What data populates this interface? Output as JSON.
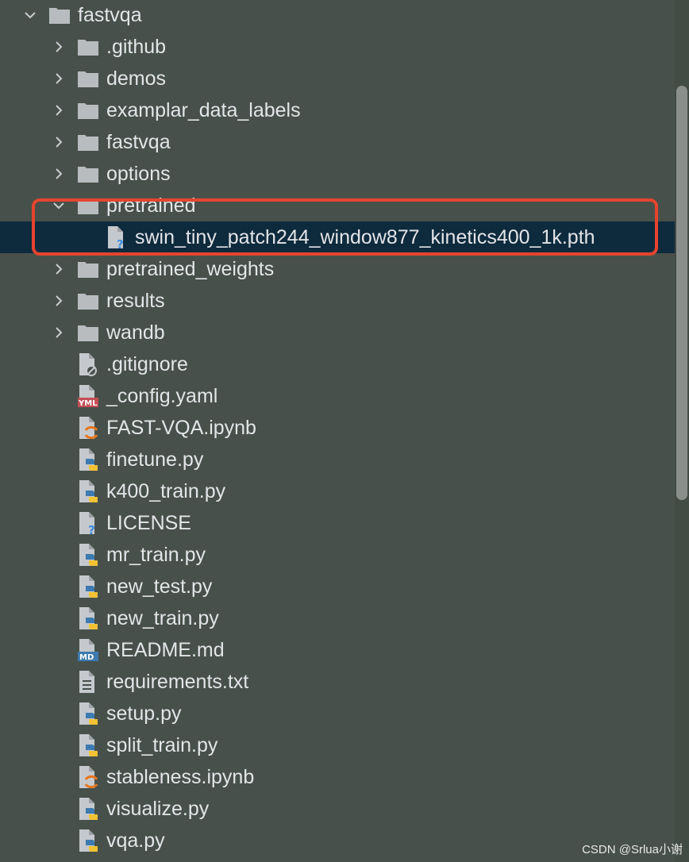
{
  "project": {
    "root": "fastvqa",
    "items": [
      {
        "label": ".github",
        "type": "folder",
        "expanded": false
      },
      {
        "label": "demos",
        "type": "folder",
        "expanded": false
      },
      {
        "label": "examplar_data_labels",
        "type": "folder",
        "expanded": false
      },
      {
        "label": "fastvqa",
        "type": "folder",
        "expanded": false
      },
      {
        "label": "options",
        "type": "folder",
        "expanded": false
      },
      {
        "label": "pretrained",
        "type": "folder",
        "expanded": true
      },
      {
        "label": "swin_tiny_patch244_window877_kinetics400_1k.pth",
        "type": "unknown",
        "child": true,
        "selected": true
      },
      {
        "label": "pretrained_weights",
        "type": "folder",
        "expanded": false
      },
      {
        "label": "results",
        "type": "folder",
        "expanded": false
      },
      {
        "label": "wandb",
        "type": "folder",
        "expanded": false
      },
      {
        "label": ".gitignore",
        "type": "ignore"
      },
      {
        "label": "_config.yaml",
        "type": "yaml"
      },
      {
        "label": "FAST-VQA.ipynb",
        "type": "notebook"
      },
      {
        "label": "finetune.py",
        "type": "python"
      },
      {
        "label": "k400_train.py",
        "type": "python"
      },
      {
        "label": "LICENSE",
        "type": "unknown"
      },
      {
        "label": "mr_train.py",
        "type": "python"
      },
      {
        "label": "new_test.py",
        "type": "python"
      },
      {
        "label": "new_train.py",
        "type": "python"
      },
      {
        "label": "README.md",
        "type": "markdown"
      },
      {
        "label": "requirements.txt",
        "type": "text"
      },
      {
        "label": "setup.py",
        "type": "python"
      },
      {
        "label": "split_train.py",
        "type": "python"
      },
      {
        "label": "stableness.ipynb",
        "type": "notebook"
      },
      {
        "label": "visualize.py",
        "type": "python"
      },
      {
        "label": "vqa.py",
        "type": "python"
      }
    ]
  },
  "icons": {
    "folder": "folder-icon",
    "unknown": "unknown-file-icon",
    "ignore": "gitignore-file-icon",
    "yaml": "yaml-file-icon",
    "notebook": "jupyter-notebook-icon",
    "python": "python-file-icon",
    "markdown": "markdown-file-icon",
    "text": "text-file-icon",
    "badge_yaml": "YML",
    "badge_md": "MD"
  },
  "colors": {
    "background": "#47504a",
    "selection": "#0e2a3d",
    "highlight": "#e6442e",
    "folder": "#b9bcbf",
    "python_blue": "#3d7ab0",
    "python_yellow": "#f1c232",
    "jupyter_orange": "#e8761b",
    "question_blue": "#3c8ee0"
  },
  "watermark": "CSDN @Srlua小谢"
}
